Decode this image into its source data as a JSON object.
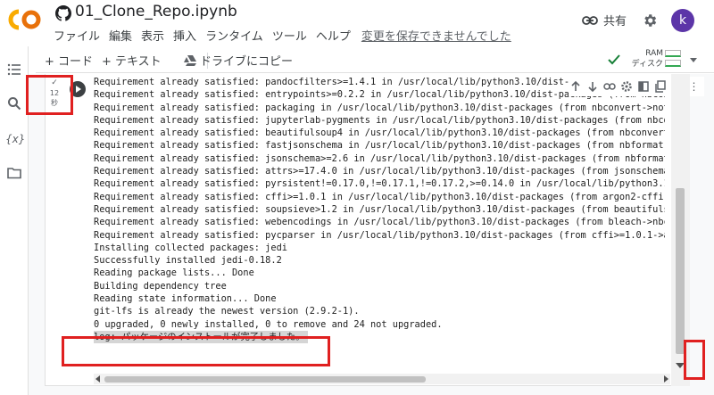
{
  "header": {
    "logo_text": "CO",
    "notebook_title": "01_Clone_Repo.ipynb",
    "menu": [
      "ファイル",
      "編集",
      "表示",
      "挿入",
      "ランタイム",
      "ツール",
      "ヘルプ"
    ],
    "save_status": "変更を保存できませんでした",
    "share_label": "共有",
    "avatar_letter": "k"
  },
  "toolbar": {
    "add_code": "+ コード",
    "add_text": "+ テキスト",
    "copy_to_drive": "ドライブにコピー",
    "ram_label": "RAM",
    "disk_label": "ディスク"
  },
  "cell": {
    "exec_check": "✓",
    "exec_time": "12",
    "exec_unit": "秒",
    "output_lines": [
      "Requirement already satisfied: pandocfilters>=1.4.1 in /usr/local/lib/python3.10/dist-pac",
      "Requirement already satisfied: entrypoints>=0.2.2 in /usr/local/lib/python3.10/dist-packages (from nbconvert->noteb",
      "Requirement already satisfied: packaging in /usr/local/lib/python3.10/dist-packages (from nbconvert->notebook>=4.4",
      "Requirement already satisfied: jupyterlab-pygments in /usr/local/lib/python3.10/dist-packages (from nbconvert->note",
      "Requirement already satisfied: beautifulsoup4 in /usr/local/lib/python3.10/dist-packages (from nbconvert->notebook",
      "Requirement already satisfied: fastjsonschema in /usr/local/lib/python3.10/dist-packages (from nbformat->notebook>",
      "Requirement already satisfied: jsonschema>=2.6 in /usr/local/lib/python3.10/dist-packages (from nbformat->notebook",
      "Requirement already satisfied: attrs>=17.4.0 in /usr/local/lib/python3.10/dist-packages (from jsonschema>=2.6->nbfo",
      "Requirement already satisfied: pyrsistent!=0.17.0,!=0.17.1,!=0.17.2,>=0.14.0 in /usr/local/lib/python3.10/dist-pack",
      "Requirement already satisfied: cffi>=1.0.1 in /usr/local/lib/python3.10/dist-packages (from argon2-cffi-bindings->",
      "Requirement already satisfied: soupsieve>1.2 in /usr/local/lib/python3.10/dist-packages (from beautifulsoup4->nbcon",
      "Requirement already satisfied: webencodings in /usr/local/lib/python3.10/dist-packages (from bleach->nbconvert->not",
      "Requirement already satisfied: pycparser in /usr/local/lib/python3.10/dist-packages (from cffi>=1.0.1->argon2-cffi-",
      "Installing collected packages: jedi",
      "Successfully installed jedi-0.18.2",
      "Reading package lists... Done",
      "Building dependency tree",
      "Reading state information... Done",
      "git-lfs is already the newest version (2.9.2-1).",
      "0 upgraded, 0 newly installed, 0 to remove and 24 not upgraded.",
      "log: パッケージのインストールが完了しました。"
    ]
  },
  "colors": {
    "logo_orange": "#f9ab00",
    "logo_dark_orange": "#e8710a",
    "avatar": "#5c35a8",
    "annotation_red": "#e02020",
    "status_green": "#34a853"
  },
  "icons": {
    "rail": [
      "menu-lines-icon",
      "search-icon",
      "variables-icon",
      "folder-icon"
    ],
    "cell_toolbar": [
      "arrow-up-icon",
      "arrow-down-icon",
      "link-icon",
      "gear-icon",
      "mirror-cell-icon",
      "copy-icon",
      "trash-icon",
      "more-vert-icon"
    ]
  }
}
